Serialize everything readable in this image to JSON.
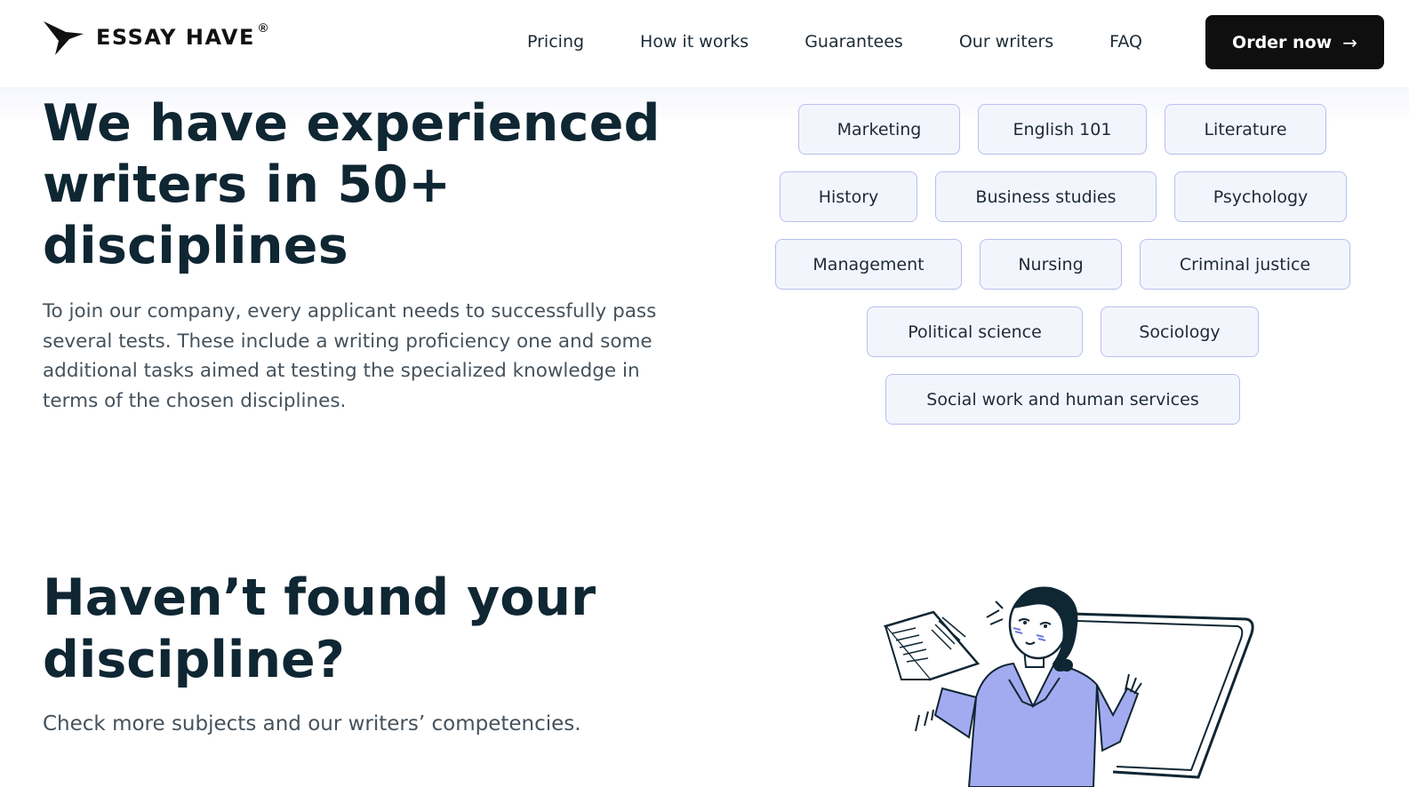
{
  "header": {
    "logo_text": "ESSAY HAVE",
    "logo_reg": "®",
    "nav": [
      "Pricing",
      "How it works",
      "Guarantees",
      "Our writers",
      "FAQ"
    ],
    "order_label": "Order now",
    "order_arrow": "→"
  },
  "hero": {
    "title": "We have experienced writers in 50+ disciplines",
    "description": "To join our company, every applicant needs to successfully pass several tests. These include a writing proficiency one and some additional tasks aimed at testing the specialized knowledge in terms of the chosen disciplines."
  },
  "disciplines": [
    "Marketing",
    "English 101",
    "Literature",
    "History",
    "Business studies",
    "Psychology",
    "Management",
    "Nursing",
    "Criminal justice",
    "Political science",
    "Sociology",
    "Social work and human services"
  ],
  "cta_section": {
    "title": "Haven’t found your discipline?",
    "subtitle": "Check more subjects and our writers’ competencies."
  },
  "colors": {
    "accent_purple": "#a3abf0",
    "dark_navy": "#0f2633",
    "chip_border": "#b8bfee",
    "chip_bg": "#f3f5fd"
  }
}
